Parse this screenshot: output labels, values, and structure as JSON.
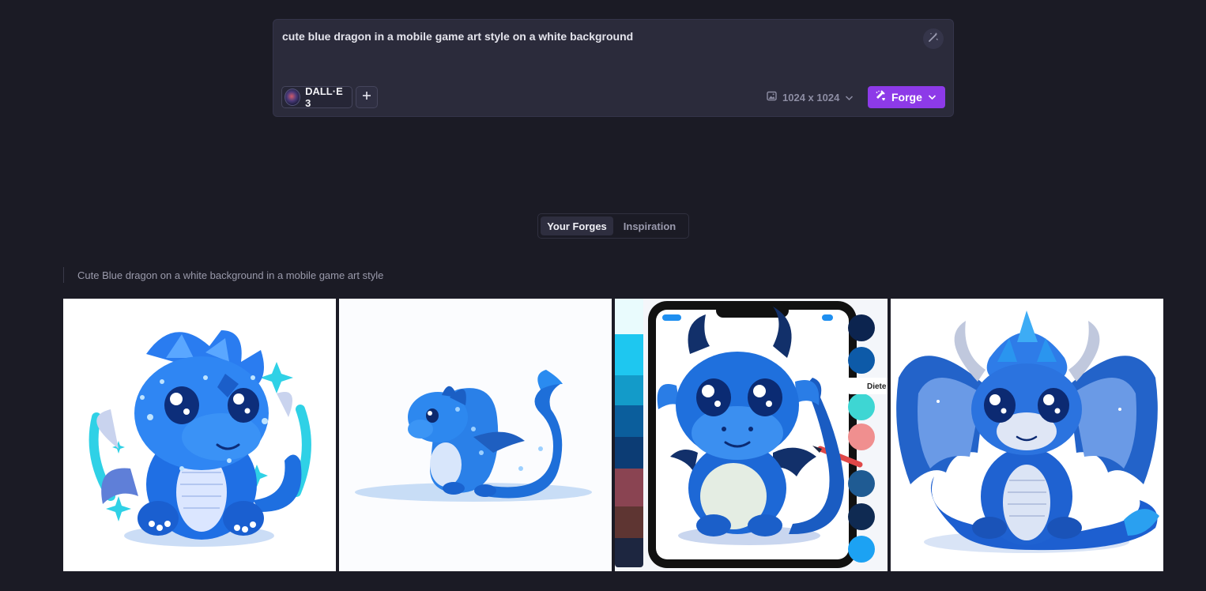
{
  "prompt": {
    "text": "cute blue dragon in a mobile game art style on a white background",
    "magic_icon": "magic-wand-icon"
  },
  "model": {
    "label": "DALL·E 3"
  },
  "size": {
    "label": "1024 x 1024",
    "icon": "image-icon"
  },
  "forge": {
    "label": "Forge",
    "icon": "anvil-icon"
  },
  "tabs": [
    {
      "label": "Your Forges",
      "active": true
    },
    {
      "label": "Inspiration",
      "active": false
    }
  ],
  "group": {
    "caption": "Cute Blue dragon on a white background in a mobile game art style"
  },
  "images": [
    {
      "alt": "sparkly blue chibi dragon sitting"
    },
    {
      "alt": "blue dragon lying down"
    },
    {
      "alt": "blue dragon on tablet with color palette",
      "tooltip_text": "Diete"
    },
    {
      "alt": "blue dragon with crystal crown and wings"
    }
  ],
  "colors": {
    "background": "#1b1b25",
    "panel": "#2b2b3b",
    "accent": "#8d3ae8"
  }
}
